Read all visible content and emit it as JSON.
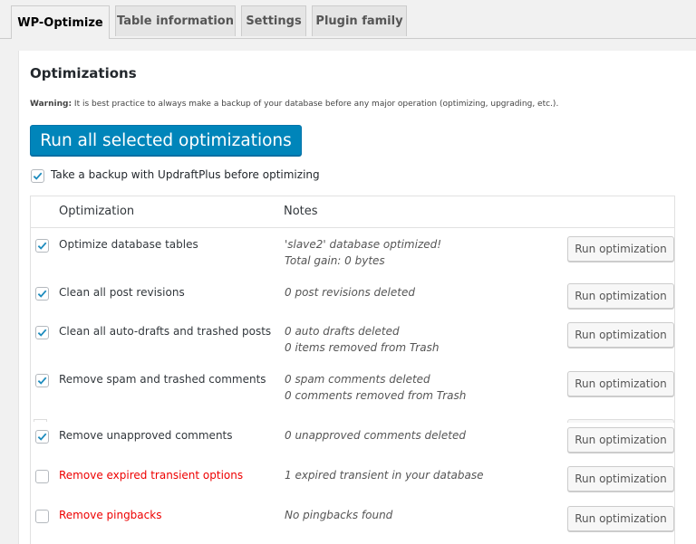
{
  "tabs": [
    {
      "label": "WP-Optimize",
      "active": true
    },
    {
      "label": "Table information",
      "active": false
    },
    {
      "label": "Settings",
      "active": false
    },
    {
      "label": "Plugin family",
      "active": false
    }
  ],
  "section": {
    "title": "Optimizations",
    "warning_label": "Warning:",
    "warning_text": " It is best practice to always make a backup of your database before any major operation (optimizing, upgrading, etc.).",
    "run_all_label": "Run all selected optimizations",
    "backup_label": "Take a backup with UpdraftPlus before optimizing",
    "backup_checked": true
  },
  "table": {
    "headers": {
      "optimization": "Optimization",
      "notes": "Notes"
    },
    "button_label": "Run optimization",
    "rows": [
      {
        "name": "Optimize database tables",
        "checked": true,
        "red": false,
        "notes": [
          "'slave2' database optimized!",
          "Total gain: 0 bytes"
        ]
      },
      {
        "name": "Clean all post revisions",
        "checked": true,
        "red": false,
        "notes": [
          "0 post revisions deleted"
        ]
      },
      {
        "name": "Clean all auto-drafts and trashed posts",
        "checked": true,
        "red": false,
        "notes": [
          "0 auto drafts deleted",
          "0 items removed from Trash"
        ]
      },
      {
        "name": "Remove spam and trashed comments",
        "checked": true,
        "red": false,
        "notes": [
          "0 spam comments deleted",
          "0 comments removed from Trash"
        ]
      },
      {
        "name": "Remove unapproved comments",
        "checked": true,
        "red": false,
        "notes": [
          "0 unapproved comments deleted"
        ]
      },
      {
        "name": "Remove expired transient options",
        "checked": false,
        "red": true,
        "notes": [
          "1 expired transient in your database"
        ]
      },
      {
        "name": "Remove pingbacks",
        "checked": false,
        "red": true,
        "notes": [
          "No pingbacks found"
        ]
      }
    ]
  },
  "colors": {
    "primary_button": "#0085ba",
    "checkbox_check": "#1e8cbe",
    "warning_row": "#ee0000"
  }
}
